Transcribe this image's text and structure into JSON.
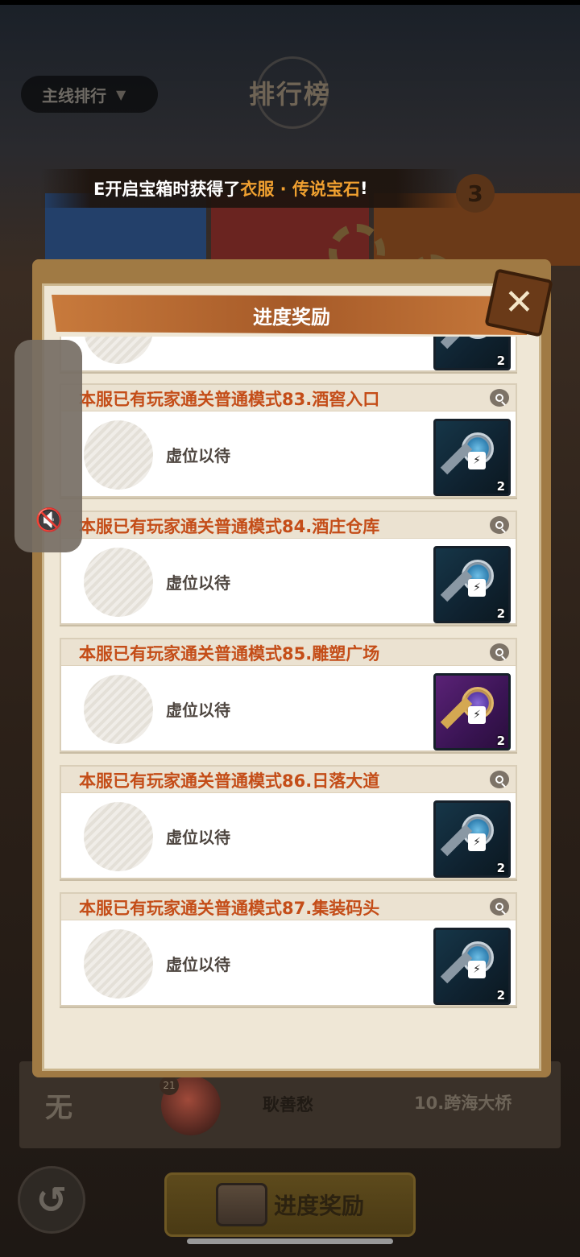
{
  "header": {
    "dropdown_label": "主线排行",
    "title": "排行榜"
  },
  "podium": {
    "third_rank": "3"
  },
  "notice": {
    "prefix": "E开启宝箱时获得了",
    "highlight": "衣服 · 传说宝石",
    "suffix": "!"
  },
  "modal": {
    "title": "进度奖励",
    "close_label": "✕",
    "placeholder_text": "虚位以待",
    "partial_item_count": "2",
    "cards": [
      {
        "title": "本服已有玩家通关普通模式83.酒窖入口",
        "placeholder": "虚位以待",
        "item_count": "2",
        "item_type": "blue-key"
      },
      {
        "title": "本服已有玩家通关普通模式84.酒庄仓库",
        "placeholder": "虚位以待",
        "item_count": "2",
        "item_type": "blue-key"
      },
      {
        "title": "本服已有玩家通关普通模式85.雕塑广场",
        "placeholder": "虚位以待",
        "item_count": "2",
        "item_type": "purple-key"
      },
      {
        "title": "本服已有玩家通关普通模式86.日落大道",
        "placeholder": "虚位以待",
        "item_count": "2",
        "item_type": "blue-key"
      },
      {
        "title": "本服已有玩家通关普通模式87.集装码头",
        "placeholder": "虚位以待",
        "item_count": "2",
        "item_type": "blue-key"
      }
    ]
  },
  "bottom": {
    "rank_none": "无",
    "avatar_level": "21",
    "player_name": "耿善愁",
    "stage": "10.跨海大桥",
    "reward_button": "进度奖励",
    "back_icon": "back-arrow-icon"
  },
  "colors": {
    "title_orange": "#c44d18",
    "highlight": "#f0a030",
    "header_band": "#b0642c"
  }
}
